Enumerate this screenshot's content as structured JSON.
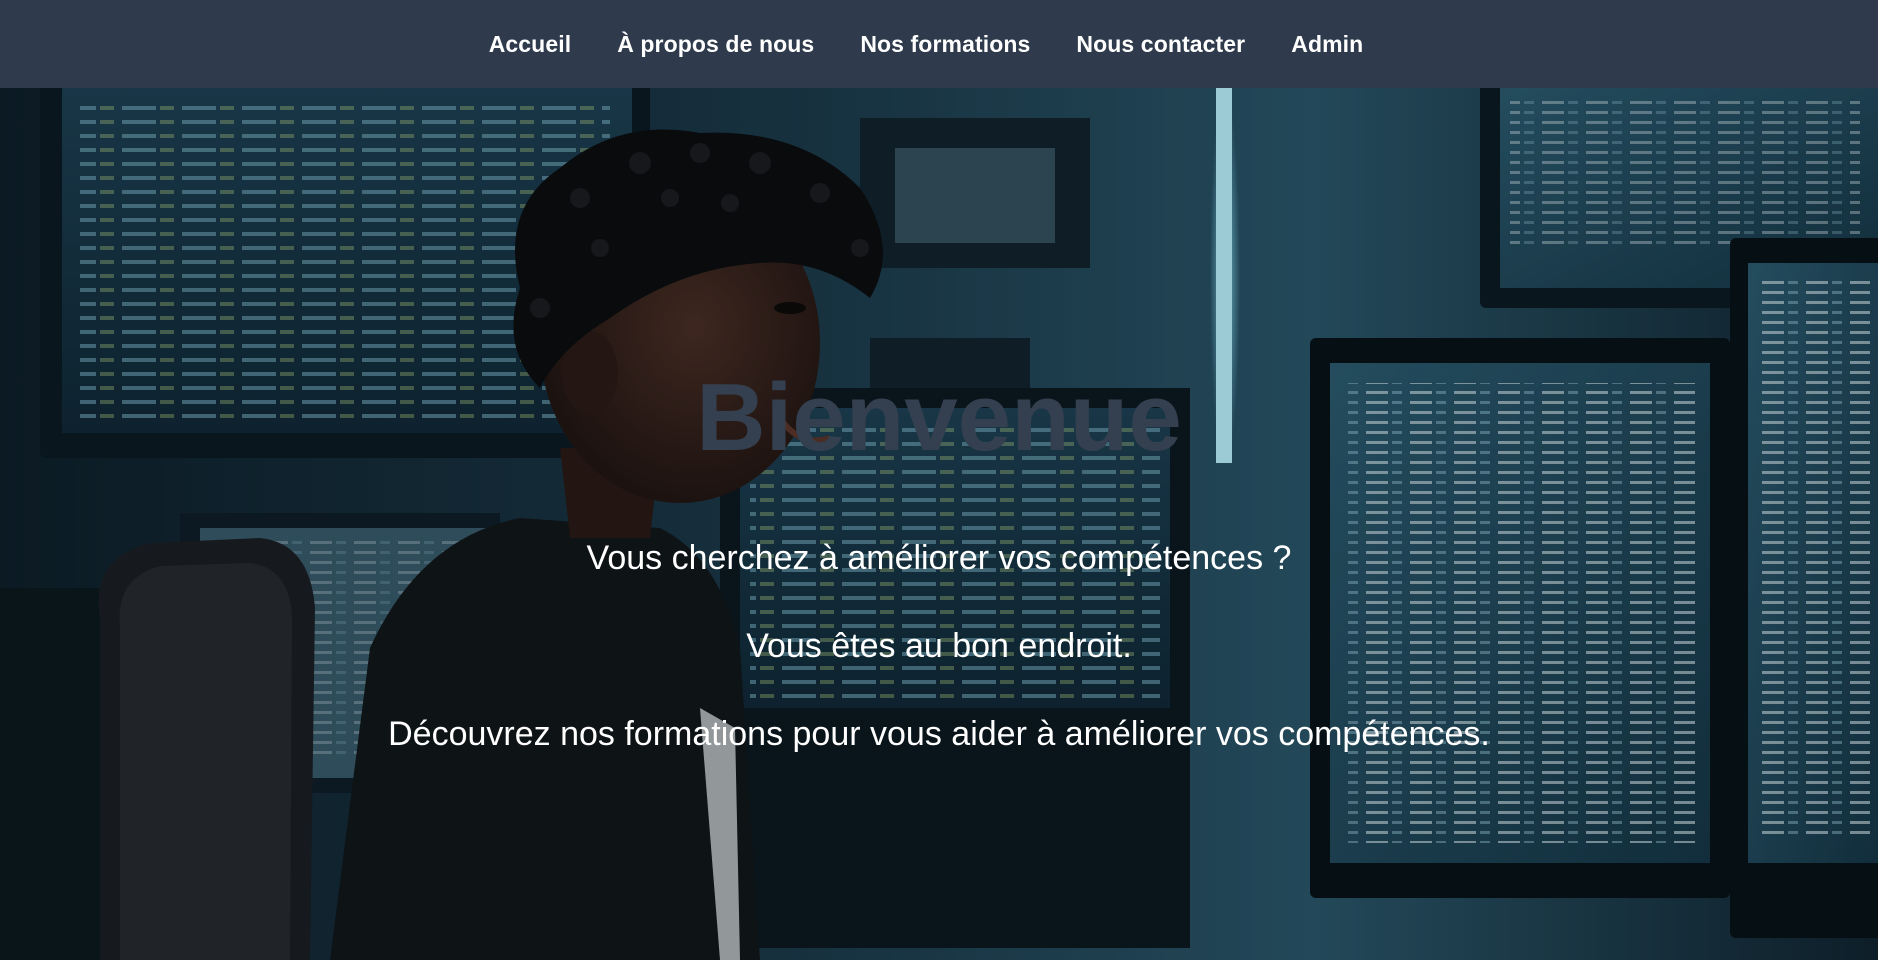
{
  "nav": {
    "items": [
      {
        "label": "Accueil"
      },
      {
        "label": "À propos de nous"
      },
      {
        "label": "Nos formations"
      },
      {
        "label": "Nous contacter"
      },
      {
        "label": "Admin"
      }
    ]
  },
  "hero": {
    "title": "Bienvenue",
    "lines": [
      "Vous cherchez à améliorer vos compétences ?",
      "Vous êtes au bon endroit.",
      "Découvrez nos formations pour vous aider à améliorer vos compétences."
    ]
  },
  "colors": {
    "navbar_bg": "#2f3b4c",
    "title_color": "#34404f",
    "text_color": "#ffffff"
  }
}
